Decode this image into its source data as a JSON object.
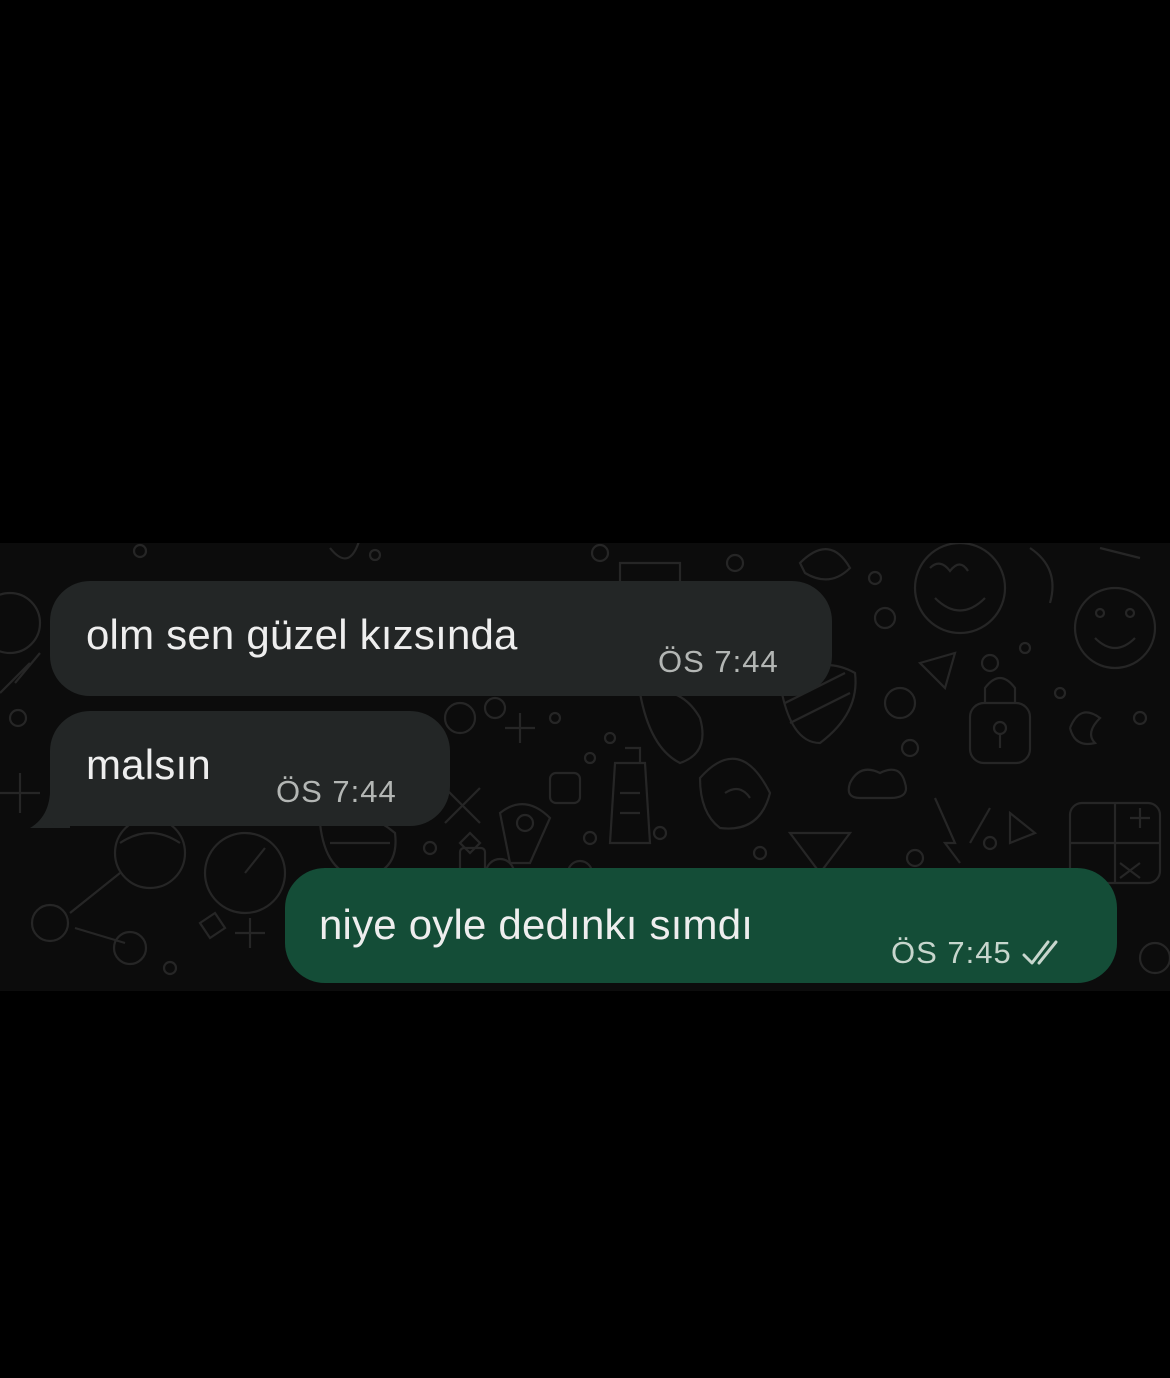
{
  "chat": {
    "messages": [
      {
        "direction": "incoming",
        "text": "olm sen güzel kızsında",
        "time": "ÖS 7:44"
      },
      {
        "direction": "incoming",
        "text": "malsın",
        "time": "ÖS 7:44"
      },
      {
        "direction": "outgoing",
        "text": "niye oyle dedınkı sımdı",
        "time": "ÖS 7:45",
        "status_icon": "double-check-icon"
      }
    ]
  },
  "colors": {
    "page_background": "#000000",
    "chat_background": "#0c0c0c",
    "incoming_bubble": "#232626",
    "outgoing_bubble": "#144d37",
    "message_text": "#eeeeee",
    "timestamp_text": "#b3b6b4"
  }
}
